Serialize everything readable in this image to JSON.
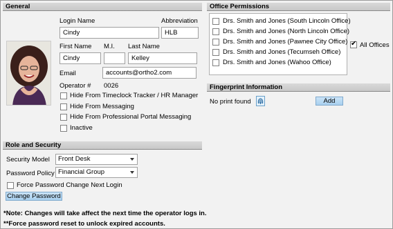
{
  "general": {
    "header": "General",
    "login_name_label": "Login Name",
    "login_name_value": "Cindy",
    "abbreviation_label": "Abbreviation",
    "abbreviation_value": "HLB",
    "first_name_label": "First Name",
    "first_name_value": "Cindy",
    "mi_label": "M.I.",
    "mi_value": "",
    "last_name_label": "Last Name",
    "last_name_value": "Kelley",
    "email_label": "Email",
    "email_value": "accounts@ortho2.com",
    "operator_label": "Operator #",
    "operator_value": "0026",
    "checkboxes": [
      {
        "label": "Hide From Timeclock Tracker / HR Manager",
        "checked": false
      },
      {
        "label": "Hide From Messaging",
        "checked": false
      },
      {
        "label": "Hide From Professional Portal Messaging",
        "checked": false
      },
      {
        "label": "Inactive",
        "checked": false
      }
    ]
  },
  "role": {
    "header": "Role and Security",
    "security_model_label": "Security Model",
    "security_model_value": "Front Desk",
    "password_policy_label": "Password Policy",
    "password_policy_value": "Financial Group",
    "force_change_label": "Force Password Change Next Login",
    "change_password_button": "Change Password"
  },
  "office": {
    "header": "Office Permissions",
    "items": [
      "Drs. Smith and Jones (South Lincoln Office)",
      "Drs. Smith and Jones (North Lincoln Office)",
      "Drs. Smith and Jones (Pawnee City Office)",
      "Drs. Smith and Jones (Tecumseh Office)",
      "Drs. Smith and Jones (Wahoo Office)"
    ],
    "all_offices_label": "All Offices",
    "all_offices_checked": true
  },
  "fingerprint": {
    "header": "Fingerprint Information",
    "status": "No print found",
    "add_button": "Add",
    "icon": "fingerprint-icon"
  },
  "notes": {
    "note1": "*Note: Changes will take affect the next time the operator logs in.",
    "note2": "**Force password reset to unlock expired accounts."
  }
}
